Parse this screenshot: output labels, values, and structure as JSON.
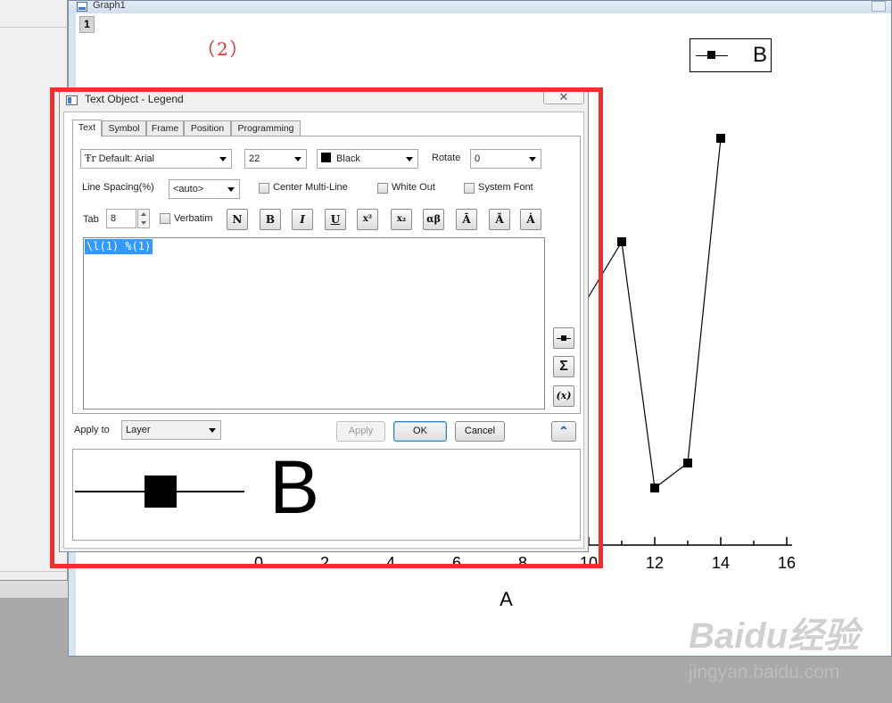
{
  "graph_window": {
    "title": "Graph1",
    "layer_tab": "1",
    "step_label": "（2）",
    "legend_text": "B"
  },
  "chart_data": {
    "type": "line",
    "x": [
      9.5,
      11,
      12,
      13,
      14
    ],
    "y": [
      6.2,
      8.5,
      1.6,
      2.3,
      11.4
    ],
    "series": [
      {
        "name": "B",
        "x": [
          9.5,
          11,
          12,
          13,
          14
        ],
        "y": [
          6.2,
          8.5,
          1.6,
          2.3,
          11.4
        ]
      }
    ],
    "x_ticks": [
      "0",
      "2",
      "4",
      "6",
      "8",
      "10",
      "12",
      "14",
      "16"
    ],
    "xlabel": "A",
    "ylabel": "",
    "title": "",
    "xlim": [
      -1,
      16
    ],
    "grid": false,
    "legend_placement": "top-right",
    "marker": "square",
    "line_color": "#000000"
  },
  "dialog": {
    "title": "Text Object - Legend",
    "close_glyph": "✕",
    "tabs": [
      "Text",
      "Symbol",
      "Frame",
      "Position",
      "Programming"
    ],
    "font": "Default: Arial",
    "font_icon": "Ŧr",
    "size": "22",
    "color": "Black",
    "rotate_label": "Rotate",
    "rotate": "0",
    "line_spacing_label": "Line Spacing(%)",
    "line_spacing": "<auto>",
    "center_multiline": "Center Multi-Line",
    "white_out": "White Out",
    "system_font": "System Font",
    "tab_label": "Tab",
    "tab_value": "8",
    "verbatim": "Verbatim",
    "format_buttons": [
      "N",
      "B",
      "I",
      "U",
      "x²",
      "x₂",
      "αβ",
      "Ā",
      "Ã",
      "Ȧ"
    ],
    "editor_text": "\\l(1) %(1)",
    "side_buttons": [
      "legend-symbol",
      "Σ",
      "(x)"
    ],
    "apply_to_label": "Apply to",
    "apply_to": "Layer",
    "apply": "Apply",
    "ok": "OK",
    "cancel": "Cancel",
    "expand_glyph": "⌃",
    "preview_text": "B"
  },
  "watermark": {
    "line1": "Baidu经验",
    "line2": "jingyan.baidu.com"
  }
}
